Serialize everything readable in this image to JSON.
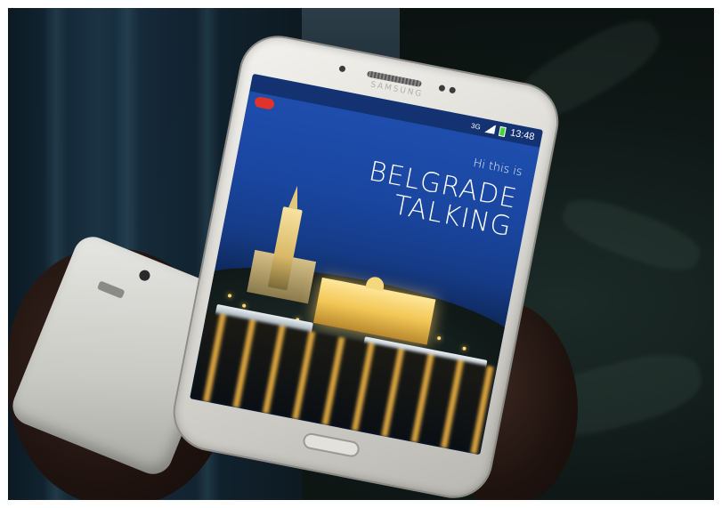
{
  "phone": {
    "brand": "SAMSUNG",
    "status_bar": {
      "time": "13:48",
      "network": "3G",
      "signal_icon": "signal-bars-icon",
      "battery_icon": "battery-icon"
    },
    "app_badge_icon": "app-notification-icon",
    "screen": {
      "intro_text": "Hi this is",
      "title_line1": "BELGRADE",
      "title_line2": "TALKING"
    }
  },
  "colors": {
    "screen_sky": "#1f4fb0",
    "city_lights": "#ffd772",
    "badge_red": "#e0332a"
  }
}
